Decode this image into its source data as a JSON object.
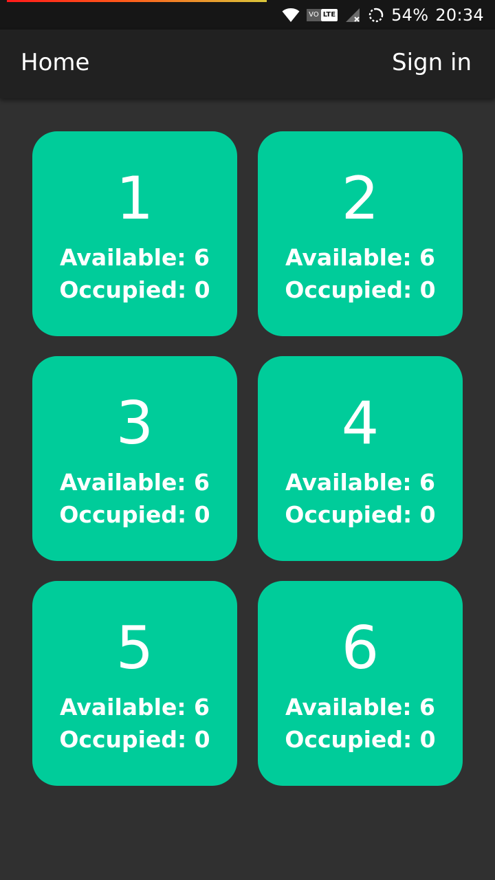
{
  "status_bar": {
    "battery": "54%",
    "time": "20:34",
    "volte_left": "VO",
    "volte_right": "LTE",
    "icons": [
      "wifi-icon",
      "volte-icon",
      "signal-icon",
      "loading-icon"
    ]
  },
  "app_bar": {
    "title": "Home",
    "sign_in": "Sign in"
  },
  "colors": {
    "tile": "#00cc9a",
    "background": "#303030",
    "app_bar": "#212121",
    "status_bar": "#161616"
  },
  "tiles": [
    {
      "number": "1",
      "available": "Available: 6",
      "occupied": "Occupied: 0"
    },
    {
      "number": "2",
      "available": "Available: 6",
      "occupied": "Occupied: 0"
    },
    {
      "number": "3",
      "available": "Available: 6",
      "occupied": "Occupied: 0"
    },
    {
      "number": "4",
      "available": "Available: 6",
      "occupied": "Occupied: 0"
    },
    {
      "number": "5",
      "available": "Available: 6",
      "occupied": "Occupied: 0"
    },
    {
      "number": "6",
      "available": "Available: 6",
      "occupied": "Occupied: 0"
    }
  ]
}
